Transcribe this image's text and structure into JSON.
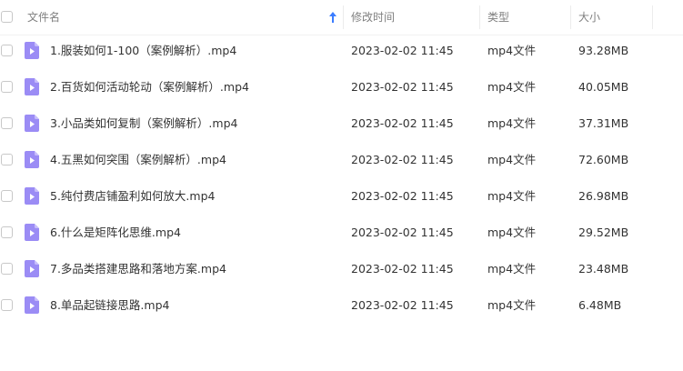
{
  "header": {
    "name_label": "文件名",
    "modified_label": "修改时间",
    "type_label": "类型",
    "size_label": "大小"
  },
  "colors": {
    "icon_purple": "#9b8cf5",
    "sort_arrow_blue": "#3b7dff",
    "header_text": "#808080",
    "row_text": "#333333"
  },
  "sort": {
    "column": "name",
    "direction": "ascending",
    "icon": "arrow-up-icon"
  },
  "files": [
    {
      "name": "1.服装如何1-100（案例解析）.mp4",
      "modified": "2023-02-02 11:45",
      "type": "mp4文件",
      "size": "93.28MB",
      "icon": "video-file-icon"
    },
    {
      "name": "2.百货如何活动轮动（案例解析）.mp4",
      "modified": "2023-02-02 11:45",
      "type": "mp4文件",
      "size": "40.05MB",
      "icon": "video-file-icon"
    },
    {
      "name": "3.小品类如何复制（案例解析）.mp4",
      "modified": "2023-02-02 11:45",
      "type": "mp4文件",
      "size": "37.31MB",
      "icon": "video-file-icon"
    },
    {
      "name": "4.五黑如何突围（案例解析）.mp4",
      "modified": "2023-02-02 11:45",
      "type": "mp4文件",
      "size": "72.60MB",
      "icon": "video-file-icon"
    },
    {
      "name": "5.纯付费店铺盈利如何放大.mp4",
      "modified": "2023-02-02 11:45",
      "type": "mp4文件",
      "size": "26.98MB",
      "icon": "video-file-icon"
    },
    {
      "name": "6.什么是矩阵化思维.mp4",
      "modified": "2023-02-02 11:45",
      "type": "mp4文件",
      "size": "29.52MB",
      "icon": "video-file-icon"
    },
    {
      "name": "7.多品类搭建思路和落地方案.mp4",
      "modified": "2023-02-02 11:45",
      "type": "mp4文件",
      "size": "23.48MB",
      "icon": "video-file-icon"
    },
    {
      "name": "8.单品起链接思路.mp4",
      "modified": "2023-02-02 11:45",
      "type": "mp4文件",
      "size": "6.48MB",
      "icon": "video-file-icon"
    }
  ]
}
